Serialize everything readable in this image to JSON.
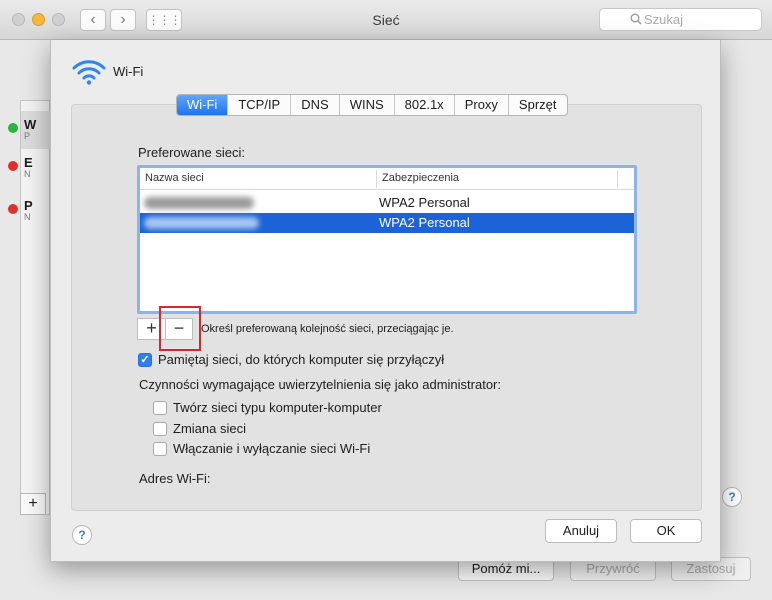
{
  "window": {
    "title": "Sieć",
    "search_placeholder": "Szukaj",
    "nav_back": "‹",
    "nav_forward": "›",
    "grid_glyph": "⋮⋮⋮"
  },
  "background": {
    "services": [
      {
        "letter": "W",
        "sub": "P",
        "status_color": "#27b53c"
      },
      {
        "letter": "E",
        "sub": "N",
        "status_color": "#e0302b"
      },
      {
        "letter": "P",
        "sub": "N",
        "status_color": "#e0302b"
      }
    ],
    "plus_label": "+",
    "help_label": "?",
    "help_button": "Pomóż mi...",
    "revert_button": "Przywróć",
    "apply_button": "Zastosuj"
  },
  "sheet": {
    "interface_name": "Wi-Fi",
    "tabs": [
      {
        "label": "Wi-Fi",
        "active": true
      },
      {
        "label": "TCP/IP",
        "active": false
      },
      {
        "label": "DNS",
        "active": false
      },
      {
        "label": "WINS",
        "active": false
      },
      {
        "label": "802.1x",
        "active": false
      },
      {
        "label": "Proxy",
        "active": false
      },
      {
        "label": "Sprzęt",
        "active": false
      }
    ],
    "preferred_label": "Preferowane sieci:",
    "columns": {
      "name": "Nazwa sieci",
      "security": "Zabezpieczenia"
    },
    "networks": [
      {
        "security": "WPA2 Personal",
        "selected": false
      },
      {
        "security": "WPA2 Personal",
        "selected": true
      }
    ],
    "add_label": "+",
    "remove_label": "−",
    "order_hint": "Określ preferowaną kolejność sieci, przeciągając je.",
    "remember": {
      "label": "Pamiętaj sieci, do których komputer się przyłączył",
      "checked": true
    },
    "admin_label": "Czynności wymagające uwierzytelnienia się jako administrator:",
    "admin_options": [
      {
        "label": "Twórz sieci typu komputer-komputer",
        "checked": false
      },
      {
        "label": "Zmiana sieci",
        "checked": false
      },
      {
        "label": "Włączanie i wyłączanie sieci Wi-Fi",
        "checked": false
      }
    ],
    "address_label": "Adres Wi-Fi:",
    "help_label": "?",
    "cancel_button": "Anuluj",
    "ok_button": "OK",
    "checkmark": "✓",
    "accent_color": "#1b63d6",
    "highlight_color": "#d8262c"
  }
}
